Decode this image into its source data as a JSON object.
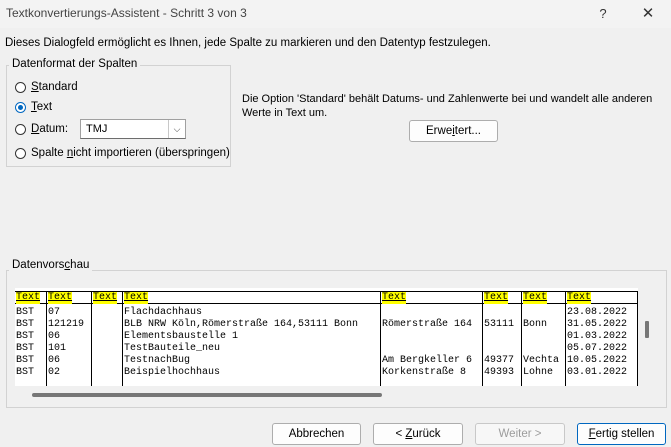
{
  "window": {
    "title": "Textkonvertierungs-Assistent - Schritt 3 von 3",
    "help_glyph": "?",
    "close_glyph": "✕"
  },
  "description": "Dieses Dialogfeld ermöglicht es Ihnen, jede Spalte zu markieren und den Datentyp festzulegen.",
  "column_format": {
    "legend": "Datenformat der Spalten",
    "options": [
      {
        "accel": "S",
        "rest": "tandard",
        "checked": false
      },
      {
        "accel": "T",
        "rest": "ext",
        "checked": true
      },
      {
        "accel": "D",
        "rest": "atum:",
        "checked": false
      },
      {
        "before": "Spalte ",
        "accel": "n",
        "rest": "icht importieren (überspringen)",
        "checked": false
      }
    ],
    "date_format": "TMJ"
  },
  "info_text": "Die Option 'Standard' behält Datums- und Zahlenwerte bei und wandelt alle anderen Werte in Text um.",
  "advanced_button": {
    "before": "Erwe",
    "accel": "i",
    "rest": "tert..."
  },
  "preview": {
    "legend_before": "Datenvors",
    "legend_accel": "c",
    "legend_rest": "hau",
    "headers": [
      "Text",
      "Text",
      "Text",
      "Text",
      "Text",
      "Text",
      "Text",
      "Text"
    ],
    "rows": [
      [
        "BST",
        "07",
        "",
        "Flachdachhaus",
        "",
        "",
        "",
        "23.08.2022"
      ],
      [
        "BST",
        "121219",
        "",
        "BLB NRW Köln,Römerstraße 164,53111 Bonn",
        "Römerstraße 164",
        "53111",
        "Bonn",
        "31.05.2022"
      ],
      [
        "BST",
        "06",
        "",
        "Elementsbaustelle 1",
        "",
        "",
        "",
        "01.03.2022"
      ],
      [
        "BST",
        "101",
        "",
        "TestBauteile_neu",
        "",
        "",
        "",
        "05.07.2022"
      ],
      [
        "BST",
        "06",
        "",
        "TestnachBug",
        "Am Bergkeller 6",
        "49377",
        "Vechta",
        "10.05.2022"
      ],
      [
        "BST",
        "02",
        "",
        "Beispielhochhaus",
        "Korkenstraße 8",
        "49393",
        "Lohne",
        "03.01.2022"
      ]
    ]
  },
  "buttons": {
    "cancel": {
      "before": "Abbrechen",
      "accel": "",
      "rest": ""
    },
    "back": {
      "before": "< ",
      "accel": "Z",
      "rest": "urück"
    },
    "next": {
      "before": "Weiter >",
      "accel": "",
      "rest": ""
    },
    "finish": {
      "before": "",
      "accel": "F",
      "rest": "ertig stellen"
    }
  },
  "colors": {
    "header_highlight": "#ffff00",
    "accent": "#0067c0"
  }
}
